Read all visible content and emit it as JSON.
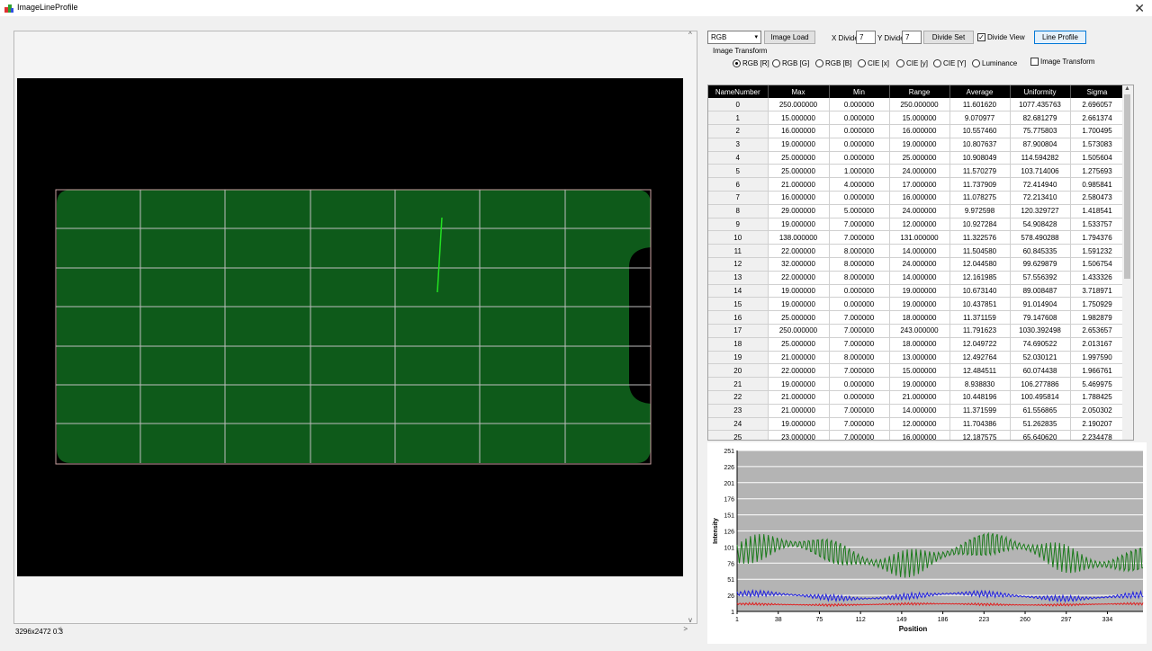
{
  "window": {
    "title": "ImageLineProfile"
  },
  "viewer": {
    "status_text": "3296x2472 0.3"
  },
  "toolbar": {
    "color_mode": "RGB",
    "image_load_label": "Image Load",
    "x_divide_label": "X Divide",
    "x_divide_value": "7",
    "y_divide_label": "Y Divide",
    "y_divide_value": "7",
    "divide_set_label": "Divide Set",
    "divide_view_label": "Divide View",
    "divide_view_checked": true,
    "line_profile_label": "Line Profile",
    "image_transform_group_title": "Image Transform",
    "image_transform_checkbox_label": "Image Transform",
    "image_transform_checked": false,
    "radios": [
      {
        "label": "RGB [R]",
        "selected": true
      },
      {
        "label": "RGB [G]",
        "selected": false
      },
      {
        "label": "RGB [B]",
        "selected": false
      },
      {
        "label": "CIE [x]",
        "selected": false
      },
      {
        "label": "CIE [y]",
        "selected": false
      },
      {
        "label": "CIE [Y]",
        "selected": false
      },
      {
        "label": "Luminance",
        "selected": false
      }
    ]
  },
  "table": {
    "columns": [
      "NameNumber",
      "Max",
      "Min",
      "Range",
      "Average",
      "Uniformity",
      "Sigma"
    ],
    "rows": [
      [
        "0",
        "250.000000",
        "0.000000",
        "250.000000",
        "11.601620",
        "1077.435763",
        "2.696057"
      ],
      [
        "1",
        "15.000000",
        "0.000000",
        "15.000000",
        "9.070977",
        "82.681279",
        "2.661374"
      ],
      [
        "2",
        "16.000000",
        "0.000000",
        "16.000000",
        "10.557460",
        "75.775803",
        "1.700495"
      ],
      [
        "3",
        "19.000000",
        "0.000000",
        "19.000000",
        "10.807637",
        "87.900804",
        "1.573083"
      ],
      [
        "4",
        "25.000000",
        "0.000000",
        "25.000000",
        "10.908049",
        "114.594282",
        "1.505604"
      ],
      [
        "5",
        "25.000000",
        "1.000000",
        "24.000000",
        "11.570279",
        "103.714006",
        "1.275693"
      ],
      [
        "6",
        "21.000000",
        "4.000000",
        "17.000000",
        "11.737909",
        "72.414940",
        "0.985841"
      ],
      [
        "7",
        "16.000000",
        "0.000000",
        "16.000000",
        "11.078275",
        "72.213410",
        "2.580473"
      ],
      [
        "8",
        "29.000000",
        "5.000000",
        "24.000000",
        "9.972598",
        "120.329727",
        "1.418541"
      ],
      [
        "9",
        "19.000000",
        "7.000000",
        "12.000000",
        "10.927284",
        "54.908428",
        "1.533757"
      ],
      [
        "10",
        "138.000000",
        "7.000000",
        "131.000000",
        "11.322576",
        "578.490288",
        "1.794376"
      ],
      [
        "11",
        "22.000000",
        "8.000000",
        "14.000000",
        "11.504580",
        "60.845335",
        "1.591232"
      ],
      [
        "12",
        "32.000000",
        "8.000000",
        "24.000000",
        "12.044580",
        "99.629879",
        "1.506754"
      ],
      [
        "13",
        "22.000000",
        "8.000000",
        "14.000000",
        "12.161985",
        "57.556392",
        "1.433326"
      ],
      [
        "14",
        "19.000000",
        "0.000000",
        "19.000000",
        "10.673140",
        "89.008487",
        "3.718971"
      ],
      [
        "15",
        "19.000000",
        "0.000000",
        "19.000000",
        "10.437851",
        "91.014904",
        "1.750929"
      ],
      [
        "16",
        "25.000000",
        "7.000000",
        "18.000000",
        "11.371159",
        "79.147608",
        "1.982879"
      ],
      [
        "17",
        "250.000000",
        "7.000000",
        "243.000000",
        "11.791623",
        "1030.392498",
        "2.653657"
      ],
      [
        "18",
        "25.000000",
        "7.000000",
        "18.000000",
        "12.049722",
        "74.690522",
        "2.013167"
      ],
      [
        "19",
        "21.000000",
        "8.000000",
        "13.000000",
        "12.492764",
        "52.030121",
        "1.997590"
      ],
      [
        "20",
        "22.000000",
        "7.000000",
        "15.000000",
        "12.484511",
        "60.074438",
        "1.966761"
      ],
      [
        "21",
        "19.000000",
        "0.000000",
        "19.000000",
        "8.938830",
        "106.277886",
        "5.469975"
      ],
      [
        "22",
        "21.000000",
        "0.000000",
        "21.000000",
        "10.448196",
        "100.495814",
        "1.788425"
      ],
      [
        "23",
        "21.000000",
        "7.000000",
        "14.000000",
        "11.371599",
        "61.556865",
        "2.050302"
      ],
      [
        "24",
        "19.000000",
        "7.000000",
        "12.000000",
        "11.704386",
        "51.262835",
        "2.190207"
      ],
      [
        "25",
        "23.000000",
        "7.000000",
        "16.000000",
        "12.187575",
        "65.640620",
        "2.234478"
      ]
    ]
  },
  "chart_data": {
    "type": "line",
    "xlabel": "Position",
    "ylabel": "Intensity",
    "xticks": [
      1,
      38,
      75,
      112,
      149,
      186,
      223,
      260,
      297,
      334
    ],
    "yticks": [
      1,
      26,
      51,
      76,
      101,
      126,
      151,
      176,
      201,
      226,
      251
    ],
    "xlim": [
      1,
      366
    ],
    "ylim": [
      1,
      251
    ],
    "grid": true,
    "series": [
      {
        "color": "#1a7a1a",
        "base": 90,
        "amp": 22,
        "swing": 16,
        "freq": 0.78
      },
      {
        "color": "#1f1fe0",
        "base": 25,
        "amp": 5,
        "swing": 4,
        "freq": 0.9
      },
      {
        "color": "#e01f1f",
        "base": 12,
        "amp": 2,
        "swing": 1,
        "freq": 1.1
      }
    ]
  }
}
